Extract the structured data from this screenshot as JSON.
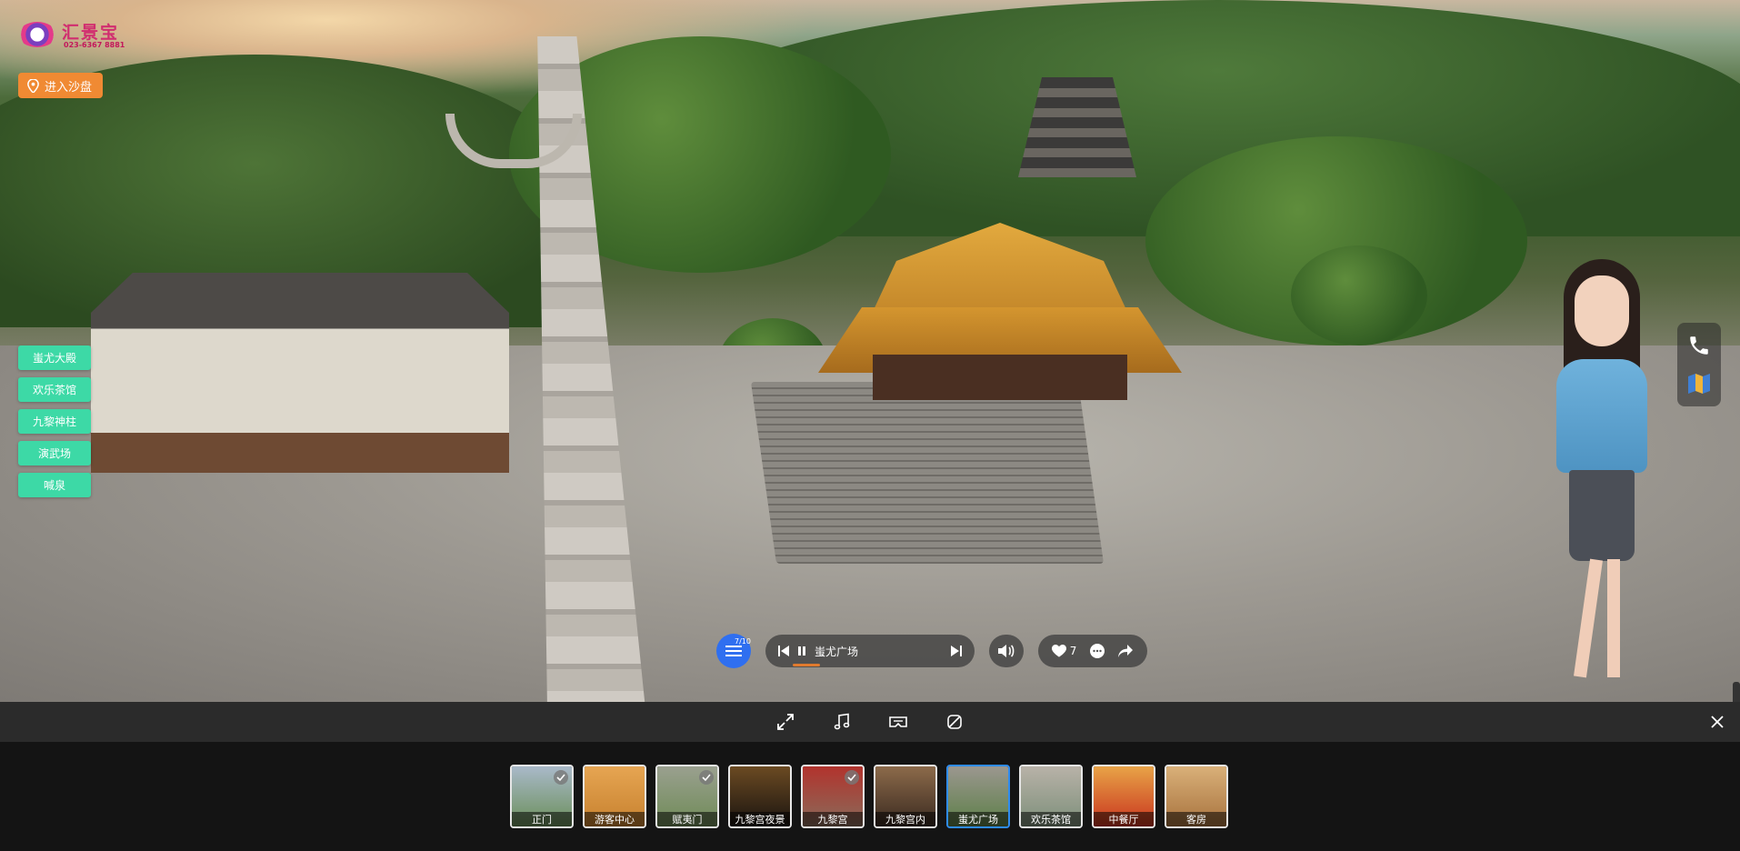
{
  "brand": {
    "title": "汇景宝",
    "phone": "023-6367 8881"
  },
  "sandbox_button": {
    "label": "进入沙盘"
  },
  "scene_links": [
    {
      "label": "蚩尤大殿"
    },
    {
      "label": "欢乐茶馆"
    },
    {
      "label": "九黎神柱"
    },
    {
      "label": "演武场"
    },
    {
      "label": "喊泉"
    }
  ],
  "player": {
    "counter": "7/10",
    "track_title": "蚩尤广场",
    "progress": 0.1
  },
  "social": {
    "likes": "7"
  },
  "side_tools": [
    "phone-icon",
    "map-icon"
  ],
  "toolbar_icons": [
    "fullscreen-icon",
    "music-icon",
    "vr-icon",
    "gyroscope-icon"
  ],
  "thumbnails": [
    {
      "label": "正门",
      "checked": true,
      "active": false,
      "colors": [
        "#6b8f5a",
        "#a9b9c9"
      ]
    },
    {
      "label": "游客中心",
      "checked": false,
      "active": false,
      "colors": [
        "#c7812f",
        "#e6a552"
      ]
    },
    {
      "label": "赋夷门",
      "checked": true,
      "active": false,
      "colors": [
        "#6f8b57",
        "#9aa08f"
      ]
    },
    {
      "label": "九黎宫夜景",
      "checked": false,
      "active": false,
      "colors": [
        "#1a1410",
        "#6b4a22"
      ]
    },
    {
      "label": "九黎宫",
      "checked": true,
      "active": false,
      "colors": [
        "#8a6b5a",
        "#b2332d"
      ]
    },
    {
      "label": "九黎宫内",
      "checked": false,
      "active": false,
      "colors": [
        "#3a2a20",
        "#8c6a4a"
      ]
    },
    {
      "label": "蚩尤广场",
      "checked": false,
      "active": true,
      "colors": [
        "#5d7f48",
        "#9b978f"
      ]
    },
    {
      "label": "欢乐茶馆",
      "checked": false,
      "active": false,
      "colors": [
        "#7d8f7a",
        "#b8b2a8"
      ]
    },
    {
      "label": "中餐厅",
      "checked": false,
      "active": false,
      "colors": [
        "#c9351f",
        "#e8a347"
      ]
    },
    {
      "label": "客房",
      "checked": false,
      "active": false,
      "colors": [
        "#a8733e",
        "#d9b079"
      ]
    }
  ],
  "colors": {
    "accent_orange": "#f08a33",
    "scene_link_green": "#3dd9a6",
    "menu_blue": "#2f6ff0",
    "active_thumb": "#2f8cf0"
  }
}
